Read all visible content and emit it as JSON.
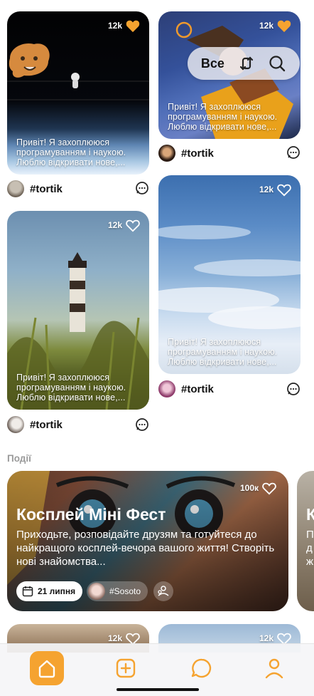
{
  "colors": {
    "accent": "#f5a330",
    "text": "#111111",
    "muted": "#9a9a9a",
    "heart_filled": "#f5a330"
  },
  "posts": [
    {
      "likes": "12k",
      "liked": true,
      "caption": "Привіт! Я захоплююся програмуванням і наукою. Люблю відкривати нове,...",
      "author": "#tortik"
    },
    {
      "likes": "12k",
      "liked": true,
      "caption": "Привіт! Я захоплююся програмуванням і наукою. Люблю відкривати нове,...",
      "author": "#tortik"
    },
    {
      "likes": "12k",
      "liked": false,
      "caption": "Привіт! Я захоплююся програмуванням і наукою. Люблю відкривати нове,...",
      "author": "#tortik"
    },
    {
      "likes": "12k",
      "liked": false,
      "caption": "Привіт! Я захоплююся програмуванням і наукою. Люблю відкривати нове,...",
      "author": "#tortik"
    },
    {
      "likes": "12k",
      "liked": false
    },
    {
      "likes": "12k",
      "liked": false
    }
  ],
  "filter": {
    "all_label": "Все",
    "icons": [
      "shuffle-icon",
      "search-icon"
    ]
  },
  "events_section": {
    "title": "Події"
  },
  "events": [
    {
      "likes": "100к",
      "title": "Косплей Міні Фест",
      "description": "Приходьте, розповідайте друзям та готуйтеся до найкращого косплей-вечора вашого життя! Створіть нові знайомства...",
      "date": "21 липня",
      "organizer": "#Sosoto"
    },
    {
      "title": "К",
      "description": "П\nд\nж"
    }
  ],
  "tabbar": {
    "icons": [
      "home-icon",
      "add-icon",
      "chat-icon",
      "profile-icon"
    ],
    "active": "home-icon"
  }
}
